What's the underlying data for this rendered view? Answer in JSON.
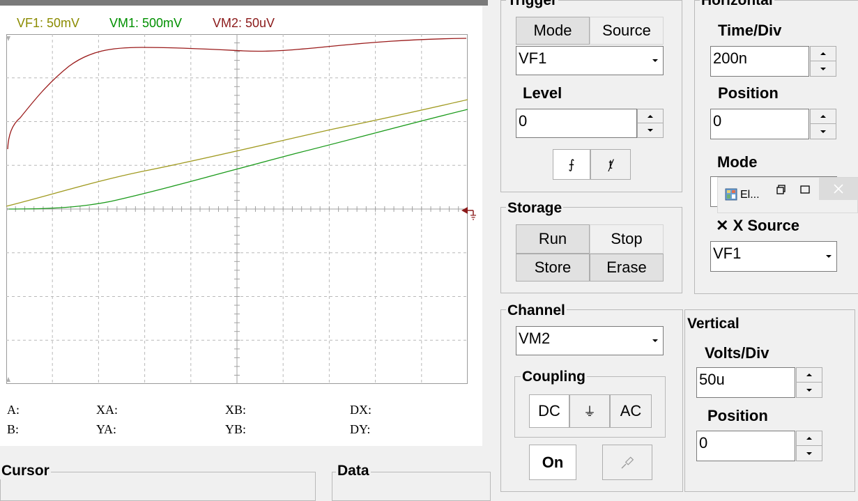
{
  "scope": {
    "channels": [
      {
        "label": "VF1: 50mV",
        "color": "#8b8b00"
      },
      {
        "label": "VM1: 500mV",
        "color": "#009000"
      },
      {
        "label": "VM2: 50uV",
        "color": "#8b1a1a"
      }
    ],
    "trace_colors": {
      "VF1": "#a09a20",
      "VM1": "#1a9a1a",
      "VM2": "#9a1a1a"
    },
    "cursor_labels": {
      "a": "A:",
      "b": "B:",
      "xa": "XA:",
      "ya": "YA:",
      "xb": "XB:",
      "yb": "YB:",
      "dx": "DX:",
      "dy": "DY:"
    }
  },
  "cursor_group_title": "Cursor",
  "data_group_title": "Data",
  "trigger": {
    "title": "Trigger",
    "tab_mode": "Mode",
    "tab_source": "Source",
    "source_value": "VF1",
    "level_label": "Level",
    "level_value": "0",
    "edge_falling": "⨍",
    "edge_rising": "ⱦ"
  },
  "horizontal": {
    "title": "Horizontal",
    "time_div_label": "Time/Div",
    "time_div_value": "200n",
    "position_label": "Position",
    "position_value": "0",
    "mode_label": "Mode",
    "x_source_label": "X Source",
    "x_source_value": "VF1"
  },
  "storage": {
    "title": "Storage",
    "run": "Run",
    "stop": "Stop",
    "store": "Store",
    "erase": "Erase"
  },
  "channel": {
    "title": "Channel",
    "value": "VM2",
    "coupling_title": "Coupling",
    "dc": "DC",
    "gnd": "⏚",
    "ac": "AC",
    "on": "On"
  },
  "vertical": {
    "title": "Vertical",
    "volts_div_label": "Volts/Div",
    "volts_div_value": "50u",
    "position_label": "Position",
    "position_value": "0"
  },
  "mini_window": {
    "title": "El...",
    "icon": "app-icon",
    "restore_icon": "restore-icon",
    "maximize_icon": "maximize-icon",
    "close_icon": "close-icon"
  }
}
